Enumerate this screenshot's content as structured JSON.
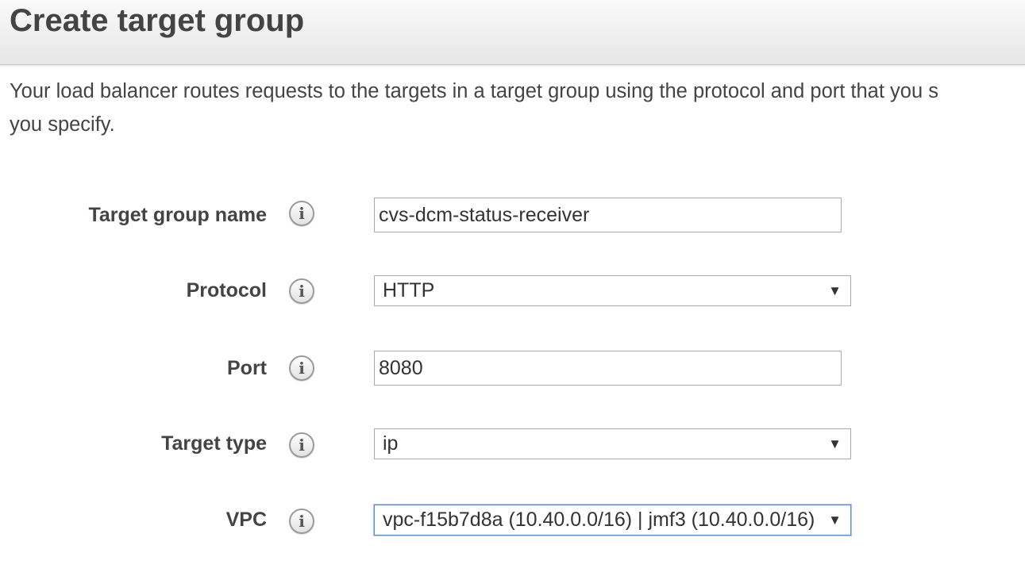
{
  "header": {
    "title": "Create target group"
  },
  "description": {
    "line1": "Your load balancer routes requests to the targets in a target group using the protocol and port that you s",
    "line2": "you specify."
  },
  "form": {
    "target_group_name": {
      "label": "Target group name",
      "value": "cvs-dcm-status-receiver"
    },
    "protocol": {
      "label": "Protocol",
      "selected": "HTTP"
    },
    "port": {
      "label": "Port",
      "value": "8080"
    },
    "target_type": {
      "label": "Target type",
      "selected": "ip"
    },
    "vpc": {
      "label": "VPC",
      "selected": "vpc-f15b7d8a (10.40.0.0/16) | jmf3 (10.40.0.0/16)"
    }
  },
  "icons": {
    "info": "i",
    "dropdown_arrow": "▼"
  },
  "colors": {
    "focus_border": "#5b8ed6",
    "text": "#444444"
  }
}
